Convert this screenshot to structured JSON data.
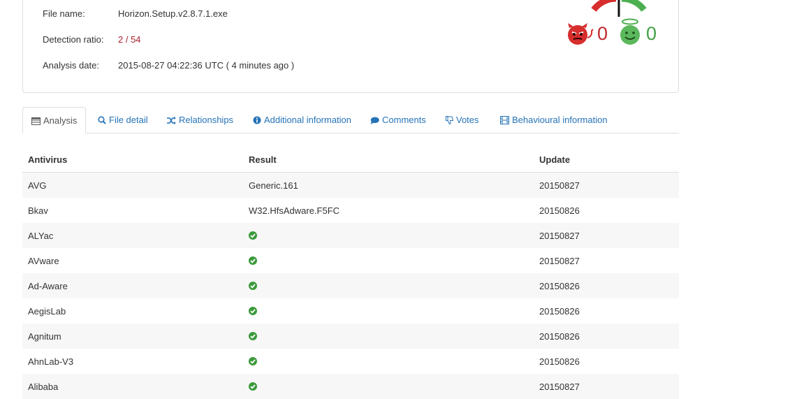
{
  "summary": {
    "file_name_label": "File name:",
    "file_name": "Horizon.Setup.v2.8.7.1.exe",
    "ratio_label": "Detection ratio:",
    "ratio": "2 / 54",
    "date_label": "Analysis date:",
    "date": "2015-08-27 04:22:36 UTC ( 4 minutes ago )"
  },
  "votes": {
    "malicious": "0",
    "harmless": "0",
    "bad_color": "#d62d2d",
    "good_color": "#4caf50"
  },
  "tabs": [
    {
      "label": "Analysis",
      "icon": "table-icon"
    },
    {
      "label": "File detail",
      "icon": "zoom-icon"
    },
    {
      "label": "Relationships",
      "icon": "shuffle-icon"
    },
    {
      "label": "Additional information",
      "icon": "info-icon"
    },
    {
      "label": "Comments",
      "icon": "comment-icon"
    },
    {
      "label": "Votes",
      "icon": "thumbs-down-icon"
    },
    {
      "label": "Behavioural information",
      "icon": "film-icon"
    }
  ],
  "table": {
    "headers": [
      "Antivirus",
      "Result",
      "Update"
    ],
    "rows": [
      {
        "av": "AVG",
        "result": "Generic.161",
        "update": "20150827"
      },
      {
        "av": "Bkav",
        "result": "W32.HfsAdware.F5FC",
        "update": "20150826"
      },
      {
        "av": "ALYac",
        "result": "",
        "update": "20150827"
      },
      {
        "av": "AVware",
        "result": "",
        "update": "20150827"
      },
      {
        "av": "Ad-Aware",
        "result": "",
        "update": "20150826"
      },
      {
        "av": "AegisLab",
        "result": "",
        "update": "20150826"
      },
      {
        "av": "Agnitum",
        "result": "",
        "update": "20150826"
      },
      {
        "av": "AhnLab-V3",
        "result": "",
        "update": "20150826"
      },
      {
        "av": "Alibaba",
        "result": "",
        "update": "20150827"
      }
    ]
  }
}
